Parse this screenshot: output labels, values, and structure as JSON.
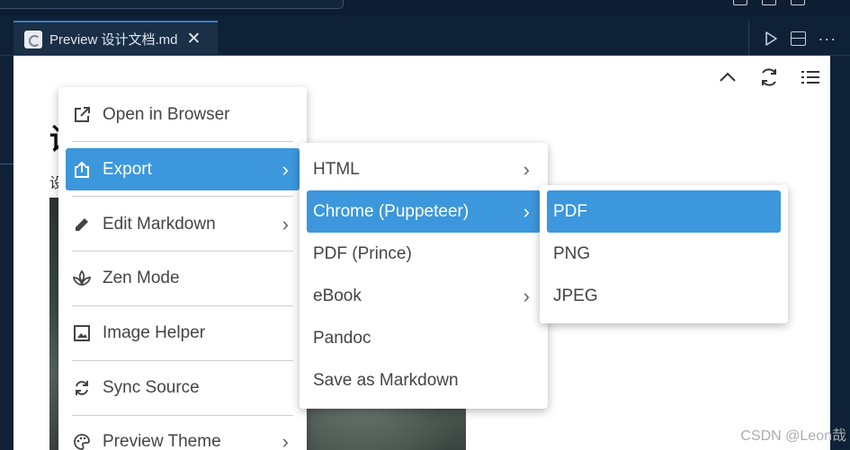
{
  "tab": {
    "title": "Preview 设计文档.md",
    "close": "✕"
  },
  "editor_actions": {
    "more": "···"
  },
  "document": {
    "heading": "设",
    "line": "设"
  },
  "main_menu": {
    "items": [
      {
        "label": "Open in Browser",
        "icon": "open-external-icon"
      },
      {
        "label": "Export",
        "icon": "export-icon",
        "submenu": true,
        "active": true
      },
      {
        "label": "Edit Markdown",
        "icon": "pencil-icon",
        "submenu": true
      },
      {
        "label": "Zen Mode",
        "icon": "spa-icon"
      },
      {
        "label": "Image Helper",
        "icon": "image-icon"
      },
      {
        "label": "Sync Source",
        "icon": "sync-icon"
      },
      {
        "label": "Preview Theme",
        "icon": "palette-icon",
        "submenu": true
      }
    ]
  },
  "export_menu": {
    "items": [
      {
        "label": "HTML",
        "submenu": true
      },
      {
        "label": "Chrome (Puppeteer)",
        "submenu": true,
        "active": true
      },
      {
        "label": "PDF (Prince)"
      },
      {
        "label": "eBook",
        "submenu": true
      },
      {
        "label": "Pandoc"
      },
      {
        "label": "Save as Markdown"
      }
    ]
  },
  "chrome_menu": {
    "items": [
      {
        "label": "PDF",
        "active": true
      },
      {
        "label": "PNG"
      },
      {
        "label": "JPEG"
      }
    ]
  },
  "chevron": "›",
  "watermark": "CSDN @Leon哉",
  "colors": {
    "accent": "#3c97dc",
    "tab_border": "#3a79c7",
    "background": "#0f2136"
  }
}
